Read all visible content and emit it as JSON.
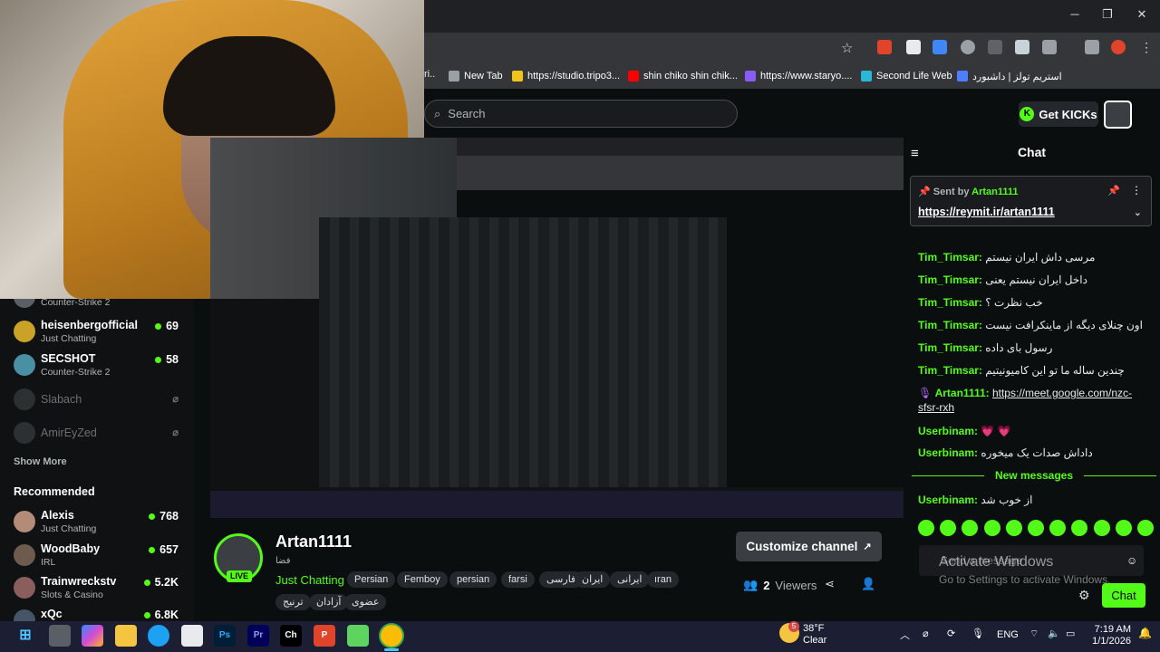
{
  "window": {
    "minimize": "─",
    "maximize": "❐",
    "close": "✕"
  },
  "bookmarks": [
    {
      "label": "New Tab",
      "color": "#9aa0a6"
    },
    {
      "label": "https://studio.tripo3...",
      "color": "#f0c419"
    },
    {
      "label": "shin chiko shin chik...",
      "color": "#ff0000"
    },
    {
      "label": "https://www.staryo....",
      "color": "#8a5cf6"
    },
    {
      "label": "Second Life Web",
      "color": "#2bb7d8"
    },
    {
      "label": "استریم تولز | داشبورد",
      "color": "#4f7dff"
    }
  ],
  "header": {
    "search_placeholder": "Search",
    "get_kicks": "Get KICKs"
  },
  "sidebar": {
    "top_item_category": "Counter-Strike 2",
    "items": [
      {
        "name": "heisenbergofficial",
        "category": "Just Chatting",
        "viewers": "69"
      },
      {
        "name": "SECSHOT",
        "category": "Counter-Strike 2",
        "viewers": "58"
      },
      {
        "name": "Slabach"
      },
      {
        "name": "AmirEyZed"
      }
    ],
    "show_more": "Show More",
    "recommended_title": "Recommended",
    "recommended": [
      {
        "name": "Alexis",
        "category": "Just Chatting",
        "viewers": "768"
      },
      {
        "name": "WoodBaby",
        "category": "IRL",
        "viewers": "657"
      },
      {
        "name": "Trainwreckstv",
        "category": "Slots & Casino",
        "viewers": "5.2K"
      },
      {
        "name": "xQc",
        "viewers": "6.8K"
      }
    ]
  },
  "stream": {
    "name": "Artan1111",
    "title": "فضا",
    "category": "Just Chatting",
    "live": "LIVE",
    "tags": [
      "Persian",
      "Femboy",
      "persian",
      "farsi",
      "فارسی",
      "ایران",
      "ایرانی",
      "ıran",
      "ترنیج",
      "آزادان",
      "عضوی"
    ],
    "customize": "Customize channel",
    "viewers_count": "2",
    "viewers_label": "Viewers"
  },
  "chat": {
    "title": "Chat",
    "pinned_sent_by": "Sent by",
    "pinned_user": "Artan1111",
    "pinned_link": "https://reymit.ir/artan1111",
    "messages": [
      {
        "user": "Tim_Timsar:",
        "text": "مرسی داش ایران نیستم"
      },
      {
        "user": "Tim_Timsar:",
        "text": "داخل ایران نیستم یعنی"
      },
      {
        "user": "Tim_Timsar:",
        "text": "خب نظرت ؟"
      },
      {
        "user": "Tim_Timsar:",
        "text": "اون چنلای دیگه از ماینکرافت نیست"
      },
      {
        "user": "Tim_Timsar:",
        "text": "رسول بای داده"
      },
      {
        "user": "Tim_Timsar:",
        "text": "چندین ساله ما تو این کامیونیتیم"
      },
      {
        "user": "Artan1111:",
        "text": "https://meet.google.com/nzc-sfsr-rxh"
      },
      {
        "user": "Userbinam:",
        "text": "💗 💗"
      },
      {
        "user": "Userbinam:",
        "text": "داداش صدات یک میخوره"
      }
    ],
    "new_messages": "New messages",
    "last_message": {
      "user": "Userbinam:",
      "text": "از خوب شد"
    },
    "input_placeholder": "Send a message",
    "chat_button": "Chat",
    "activate_windows": "Activate Windows",
    "activate_windows_sub": "Go to Settings to activate Windows."
  },
  "taskbar": {
    "apps": [
      "Ps",
      "Pr",
      "Ch",
      "P"
    ],
    "weather_temp": "38°F",
    "weather_desc": "Clear",
    "weather_badge": "5",
    "lang": "ENG",
    "time": "7:19 AM",
    "date": "1/1/2026"
  }
}
